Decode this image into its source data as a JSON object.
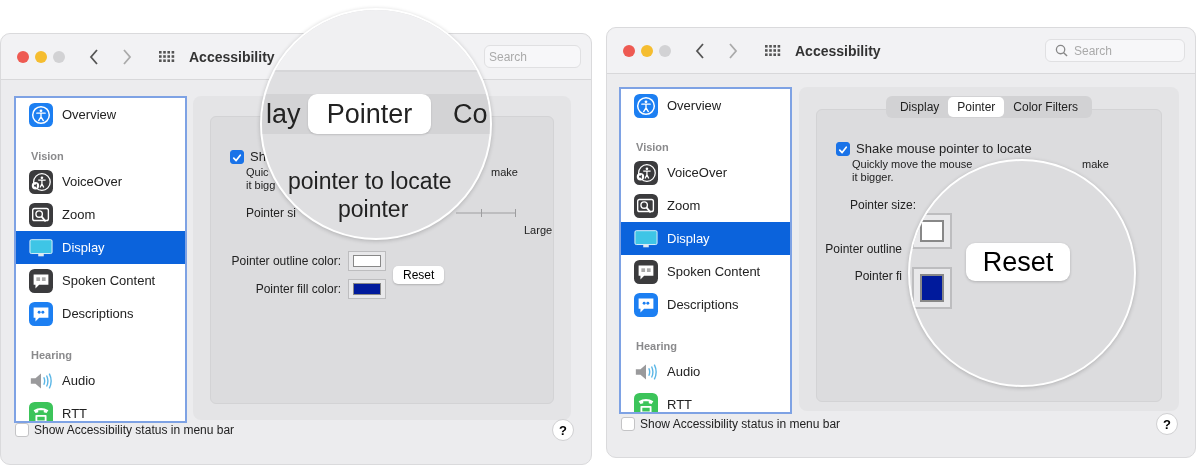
{
  "windows": [
    {
      "title": "Accessibility",
      "search": {
        "placeholder": "Search"
      },
      "sidebar": [
        {
          "kind": "item",
          "label": "Overview",
          "selected": false
        },
        {
          "kind": "header",
          "label": "Vision"
        },
        {
          "kind": "item",
          "label": "VoiceOver",
          "selected": false
        },
        {
          "kind": "item",
          "label": "Zoom",
          "selected": false
        },
        {
          "kind": "item",
          "label": "Display",
          "selected": true
        },
        {
          "kind": "item",
          "label": "Spoken Content",
          "selected": false
        },
        {
          "kind": "item",
          "label": "Descriptions",
          "selected": false
        },
        {
          "kind": "header",
          "label": "Hearing"
        },
        {
          "kind": "item",
          "label": "Audio",
          "selected": false
        },
        {
          "kind": "item",
          "label": "RTT",
          "selected": false
        }
      ],
      "pane": {
        "checkbox": {
          "label": "Sh",
          "checked": true
        },
        "hint": {
          "start": "Quic",
          "end": "make",
          "second_line": "it bigg"
        },
        "size_label": "Pointer si",
        "slider_max": "Large",
        "outline": {
          "label": "Pointer outline color:",
          "color": "#ffffff"
        },
        "fill": {
          "label": "Pointer fill color:",
          "color": "#001a9c"
        },
        "reset": "Reset"
      },
      "magnifier": {
        "tabs": [
          {
            "label": "lay",
            "selected": false
          },
          {
            "label": "Pointer",
            "selected": true
          },
          {
            "label": "Co",
            "selected": false
          }
        ],
        "lines": [
          "pointer to locate",
          "pointer"
        ]
      },
      "footer": {
        "checkbox": {
          "label": "Show Accessibility status in menu bar",
          "checked": false
        },
        "help": "?"
      }
    },
    {
      "title": "Accessibility",
      "search": {
        "placeholder": "Search"
      },
      "sidebar": [
        {
          "kind": "item",
          "label": "Overview",
          "selected": false
        },
        {
          "kind": "header",
          "label": "Vision"
        },
        {
          "kind": "item",
          "label": "VoiceOver",
          "selected": false
        },
        {
          "kind": "item",
          "label": "Zoom",
          "selected": false
        },
        {
          "kind": "item",
          "label": "Display",
          "selected": true
        },
        {
          "kind": "item",
          "label": "Spoken Content",
          "selected": false
        },
        {
          "kind": "item",
          "label": "Descriptions",
          "selected": false
        },
        {
          "kind": "header",
          "label": "Hearing"
        },
        {
          "kind": "item",
          "label": "Audio",
          "selected": false
        },
        {
          "kind": "item",
          "label": "RTT",
          "selected": false
        }
      ],
      "pane": {
        "tabs": [
          {
            "label": "Display",
            "selected": false
          },
          {
            "label": "Pointer",
            "selected": true
          },
          {
            "label": "Color Filters",
            "selected": false
          }
        ],
        "checkbox": {
          "label": "Shake mouse pointer to locate",
          "checked": true
        },
        "hint": {
          "start": "Quickly move the mouse",
          "end": "make",
          "second_line": "it bigger."
        },
        "size_label": "Pointer size:",
        "outline": {
          "label": "Pointer outline"
        },
        "fill": {
          "label": "Pointer fi"
        }
      },
      "magnifier": {
        "reset": "Reset",
        "outline": {
          "color": "#ffffff"
        },
        "fill": {
          "color": "#001a9c"
        }
      },
      "footer": {
        "checkbox": {
          "label": "Show Accessibility status in menu bar",
          "checked": false
        },
        "help": "?"
      }
    }
  ]
}
